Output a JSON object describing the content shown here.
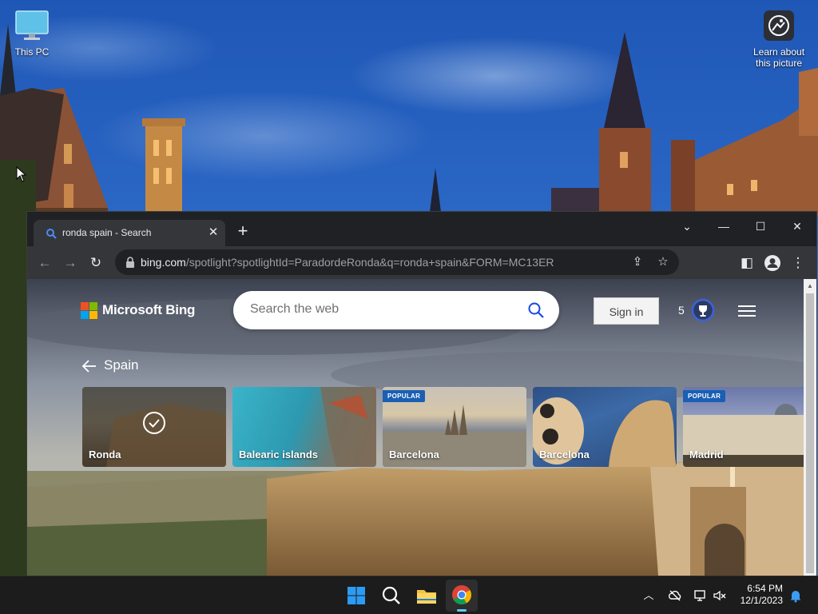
{
  "desktop": {
    "icons": [
      {
        "label": "This PC"
      },
      {
        "label_line1": "Learn about",
        "label_line2": "this picture"
      }
    ]
  },
  "browser": {
    "tab_title": "ronda spain - Search",
    "url_host": "bing.com",
    "url_path": "/spotlight?spotlightId=ParadordeRonda&q=ronda+spain&FORM=MC13ER"
  },
  "bing": {
    "brand": "Microsoft Bing",
    "search_placeholder": "Search the web",
    "sign_in": "Sign in",
    "rewards_count": "5",
    "back_label": "Spain",
    "cards": [
      {
        "label": "Ronda",
        "badge": "",
        "selected": true
      },
      {
        "label": "Balearic islands",
        "badge": ""
      },
      {
        "label": "Barcelona",
        "badge": "POPULAR"
      },
      {
        "label": "Barcelona",
        "badge": ""
      },
      {
        "label": "Madrid",
        "badge": "POPULAR"
      }
    ]
  },
  "taskbar": {
    "time": "6:54 PM",
    "date": "12/1/2023"
  },
  "colors": {
    "bing_accent": "#174ae4",
    "badge_blue": "#1a5fb4",
    "chrome_dark": "#202124",
    "chrome_toolbar": "#35363a"
  }
}
